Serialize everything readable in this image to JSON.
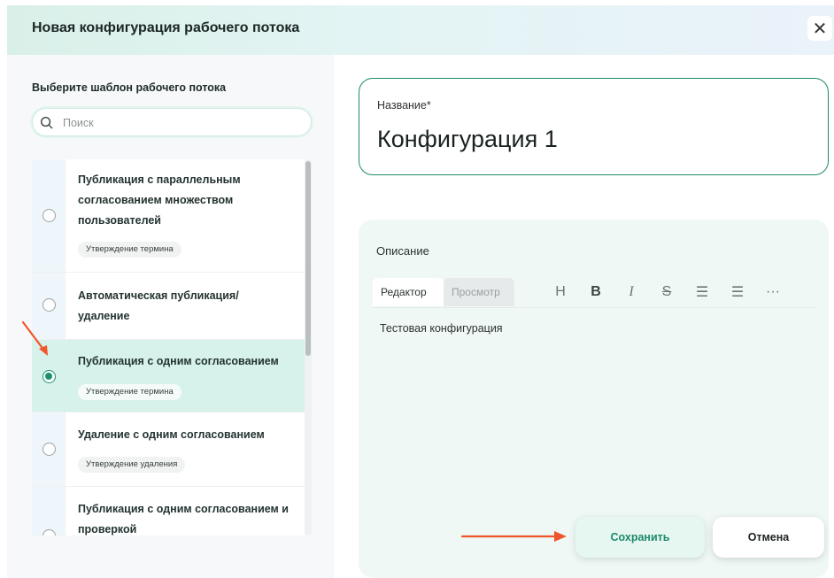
{
  "dialog": {
    "title": "Новая конфигурация рабочего потока",
    "close_icon": "close-icon",
    "close_glyph": "✕"
  },
  "templates": {
    "heading": "Выберите шаблон рабочего потока",
    "search": {
      "placeholder": "Поиск",
      "value": ""
    },
    "items": [
      {
        "title": "Публикация с параллельным согласованием множеством пользователей",
        "tag": "Утверждение термина",
        "selected": false
      },
      {
        "title": "Автоматическая публикация/ удаление",
        "tag": "",
        "selected": false
      },
      {
        "title": "Публикация с одним согласованием",
        "tag": "Утверждение термина",
        "selected": true
      },
      {
        "title": "Удаление с одним согласованием",
        "tag": "Утверждение удаления",
        "selected": false
      },
      {
        "title": "Публикация с одним согласованием и проверкой",
        "tag": "",
        "selected": false
      }
    ]
  },
  "form": {
    "name_label": "Название*",
    "name_value": "Конфигурация 1",
    "description_label": "Описание",
    "tabs": {
      "editor": "Редактор",
      "preview": "Просмотр"
    },
    "toolbar": [
      {
        "icon": "heading-icon",
        "glyph": "H"
      },
      {
        "icon": "bold-icon",
        "glyph": "B"
      },
      {
        "icon": "italic-icon",
        "glyph": "I"
      },
      {
        "icon": "strikethrough-icon",
        "glyph": "S"
      },
      {
        "icon": "bullet-list-icon",
        "glyph": "☰"
      },
      {
        "icon": "numbered-list-icon",
        "glyph": "☰"
      },
      {
        "icon": "more-icon",
        "glyph": "···"
      }
    ],
    "description_value": "Тестовая конфигурация"
  },
  "actions": {
    "save": "Сохранить",
    "cancel": "Отмена"
  },
  "colors": {
    "accent": "#1d8a6c",
    "annotation_arrow": "#f0562c",
    "selected_row": "#d6f2ea"
  }
}
